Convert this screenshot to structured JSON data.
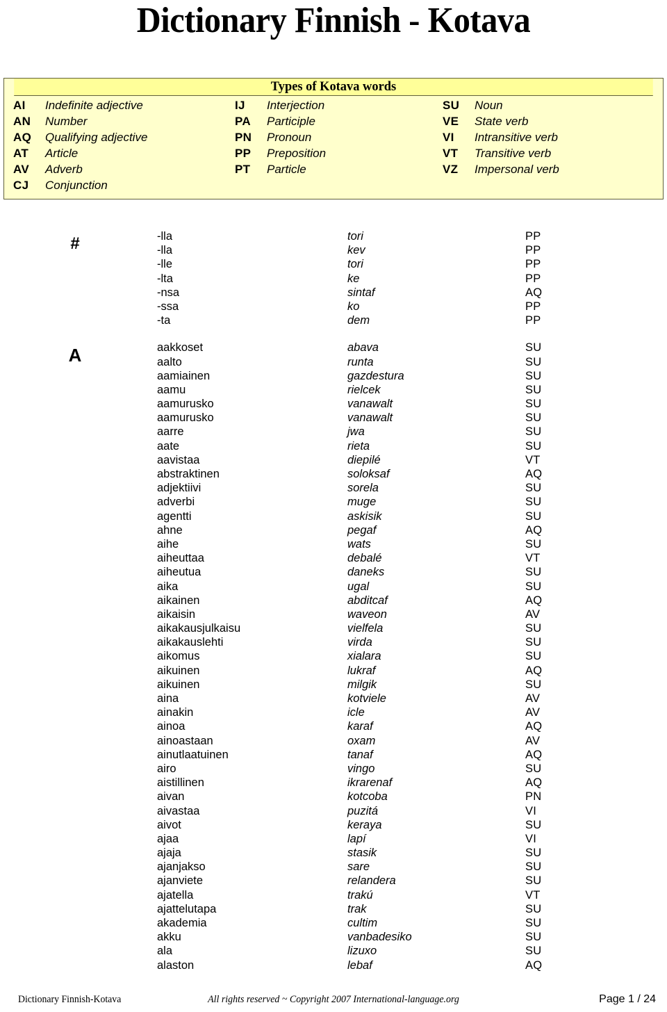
{
  "document": {
    "title": "Dictionary Finnish - Kotava"
  },
  "legend": {
    "title": "Types of Kotava words",
    "rows": [
      [
        {
          "code": "AI",
          "label": "Indefinite adjective"
        },
        {
          "code": "IJ",
          "label": "Interjection"
        },
        {
          "code": "SU",
          "label": "Noun"
        }
      ],
      [
        {
          "code": "AN",
          "label": "Number"
        },
        {
          "code": "PA",
          "label": "Participle"
        },
        {
          "code": "VE",
          "label": "State verb"
        }
      ],
      [
        {
          "code": "AQ",
          "label": "Qualifying adjective"
        },
        {
          "code": "PN",
          "label": "Pronoun"
        },
        {
          "code": "VI",
          "label": "Intransitive verb"
        }
      ],
      [
        {
          "code": "AT",
          "label": "Article"
        },
        {
          "code": "PP",
          "label": "Preposition"
        },
        {
          "code": "VT",
          "label": "Transitive verb"
        }
      ],
      [
        {
          "code": "AV",
          "label": "Adverb"
        },
        {
          "code": "PT",
          "label": "Particle"
        },
        {
          "code": "VZ",
          "label": "Impersonal verb"
        }
      ],
      [
        {
          "code": "CJ",
          "label": "Conjunction"
        },
        {
          "code": "",
          "label": ""
        },
        {
          "code": "",
          "label": ""
        }
      ]
    ]
  },
  "sections": [
    {
      "letter": "#",
      "entries": [
        {
          "finnish": "-lla",
          "kotava": "tori",
          "type": "PP"
        },
        {
          "finnish": "-lla",
          "kotava": "kev",
          "type": "PP"
        },
        {
          "finnish": "-lle",
          "kotava": "tori",
          "type": "PP"
        },
        {
          "finnish": "-lta",
          "kotava": "ke",
          "type": "PP"
        },
        {
          "finnish": "-nsa",
          "kotava": "sintaf",
          "type": "AQ"
        },
        {
          "finnish": "-ssa",
          "kotava": "ko",
          "type": "PP"
        },
        {
          "finnish": "-ta",
          "kotava": "dem",
          "type": "PP"
        }
      ]
    },
    {
      "letter": "A",
      "entries": [
        {
          "finnish": "aakkoset",
          "kotava": "abava",
          "type": "SU"
        },
        {
          "finnish": "aalto",
          "kotava": "runta",
          "type": "SU"
        },
        {
          "finnish": "aamiainen",
          "kotava": "gazdestura",
          "type": "SU"
        },
        {
          "finnish": "aamu",
          "kotava": "rielcek",
          "type": "SU"
        },
        {
          "finnish": "aamurusko",
          "kotava": "vanawalt",
          "type": "SU"
        },
        {
          "finnish": "aamurusko",
          "kotava": "vanawalt",
          "type": "SU"
        },
        {
          "finnish": "aarre",
          "kotava": "jwa",
          "type": "SU"
        },
        {
          "finnish": "aate",
          "kotava": "rieta",
          "type": "SU"
        },
        {
          "finnish": "aavistaa",
          "kotava": "diepilé",
          "type": "VT"
        },
        {
          "finnish": "abstraktinen",
          "kotava": "soloksaf",
          "type": "AQ"
        },
        {
          "finnish": "adjektiivi",
          "kotava": "sorela",
          "type": "SU"
        },
        {
          "finnish": "adverbi",
          "kotava": "muge",
          "type": "SU"
        },
        {
          "finnish": "agentti",
          "kotava": "askisik",
          "type": "SU"
        },
        {
          "finnish": "ahne",
          "kotava": "pegaf",
          "type": "AQ"
        },
        {
          "finnish": "aihe",
          "kotava": "wats",
          "type": "SU"
        },
        {
          "finnish": "aiheuttaa",
          "kotava": "debalé",
          "type": "VT"
        },
        {
          "finnish": "aiheutua",
          "kotava": "daneks",
          "type": "SU"
        },
        {
          "finnish": "aika",
          "kotava": "ugal",
          "type": "SU"
        },
        {
          "finnish": "aikainen",
          "kotava": "abditcaf",
          "type": "AQ"
        },
        {
          "finnish": "aikaisin",
          "kotava": "waveon",
          "type": "AV"
        },
        {
          "finnish": "aikakausjulkaisu",
          "kotava": "vielfela",
          "type": "SU"
        },
        {
          "finnish": "aikakauslehti",
          "kotava": "virda",
          "type": "SU"
        },
        {
          "finnish": "aikomus",
          "kotava": "xialara",
          "type": "SU"
        },
        {
          "finnish": "aikuinen",
          "kotava": "lukraf",
          "type": "AQ"
        },
        {
          "finnish": "aikuinen",
          "kotava": "milgik",
          "type": "SU"
        },
        {
          "finnish": "aina",
          "kotava": "kotviele",
          "type": "AV"
        },
        {
          "finnish": "ainakin",
          "kotava": "icle",
          "type": "AV"
        },
        {
          "finnish": "ainoa",
          "kotava": "karaf",
          "type": "AQ"
        },
        {
          "finnish": "ainoastaan",
          "kotava": "oxam",
          "type": "AV"
        },
        {
          "finnish": "ainutlaatuinen",
          "kotava": "tanaf",
          "type": "AQ"
        },
        {
          "finnish": "airo",
          "kotava": "vingo",
          "type": "SU"
        },
        {
          "finnish": "aistillinen",
          "kotava": "ikrarenaf",
          "type": "AQ"
        },
        {
          "finnish": "aivan",
          "kotava": "kotcoba",
          "type": "PN"
        },
        {
          "finnish": "aivastaa",
          "kotava": "puzitá",
          "type": "VI"
        },
        {
          "finnish": "aivot",
          "kotava": "keraya",
          "type": "SU"
        },
        {
          "finnish": "ajaa",
          "kotava": "lapí",
          "type": "VI"
        },
        {
          "finnish": "ajaja",
          "kotava": "stasik",
          "type": "SU"
        },
        {
          "finnish": "ajanjakso",
          "kotava": "sare",
          "type": "SU"
        },
        {
          "finnish": "ajanviete",
          "kotava": "relandera",
          "type": "SU"
        },
        {
          "finnish": "ajatella",
          "kotava": "trakú",
          "type": "VT"
        },
        {
          "finnish": "ajattelutapa",
          "kotava": "trak",
          "type": "SU"
        },
        {
          "finnish": "akademia",
          "kotava": "cultim",
          "type": "SU"
        },
        {
          "finnish": "akku",
          "kotava": "vanbadesiko",
          "type": "SU"
        },
        {
          "finnish": "ala",
          "kotava": "lizuxo",
          "type": "SU"
        },
        {
          "finnish": "alaston",
          "kotava": "lebaf",
          "type": "AQ"
        }
      ]
    }
  ],
  "footer": {
    "left": "Dictionary Finnish-Kotava",
    "center": "All rights reserved ~ Copyright 2007 International-language.org",
    "right": "Page 1 / 24"
  },
  "colors": {
    "legend_header_bg": "#FFFF99",
    "legend_body_bg": "#FFFFCC",
    "legend_border": "#60603A",
    "text": "#000000"
  }
}
